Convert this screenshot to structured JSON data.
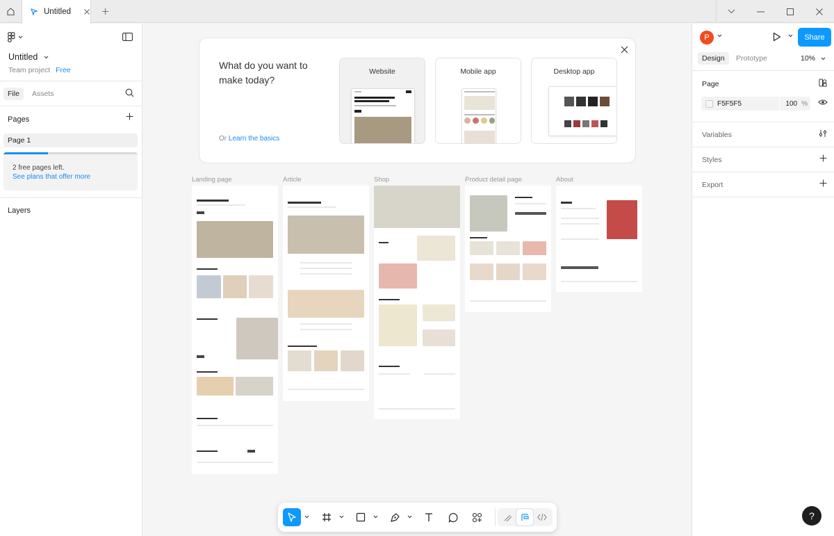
{
  "titlebar": {
    "tab_label": "Untitled"
  },
  "left": {
    "file_title": "Untitled",
    "team": "Team project",
    "plan": "Free",
    "tabs": {
      "file": "File",
      "assets": "Assets"
    },
    "pages_label": "Pages",
    "pages": [
      {
        "label": "Page 1"
      }
    ],
    "free_pages_progress": 0.33,
    "free_pages": "2 free pages left.",
    "see_plans": "See plans that offer more",
    "layers_label": "Layers"
  },
  "right": {
    "avatar_initial": "P",
    "share": "Share",
    "tabs": {
      "design": "Design",
      "prototype": "Prototype"
    },
    "zoom": "10%",
    "page_label": "Page",
    "fill_hex": "F5F5F5",
    "fill_opacity": "100",
    "fill_unit": "%",
    "variables": "Variables",
    "styles": "Styles",
    "export": "Export"
  },
  "welcome": {
    "heading": "What do you want to make today?",
    "or": "Or",
    "learn": "Learn the basics",
    "cards": [
      {
        "label": "Website"
      },
      {
        "label": "Mobile app"
      },
      {
        "label": "Desktop app"
      }
    ]
  },
  "frames": [
    {
      "label": "Landing page"
    },
    {
      "label": "Article"
    },
    {
      "label": "Shop"
    },
    {
      "label": "Product detail page"
    },
    {
      "label": "About"
    }
  ],
  "help": "?",
  "colors": {
    "accent": "#0d99ff",
    "avatar": "#f04d1f",
    "link": "#1a8cf0"
  }
}
